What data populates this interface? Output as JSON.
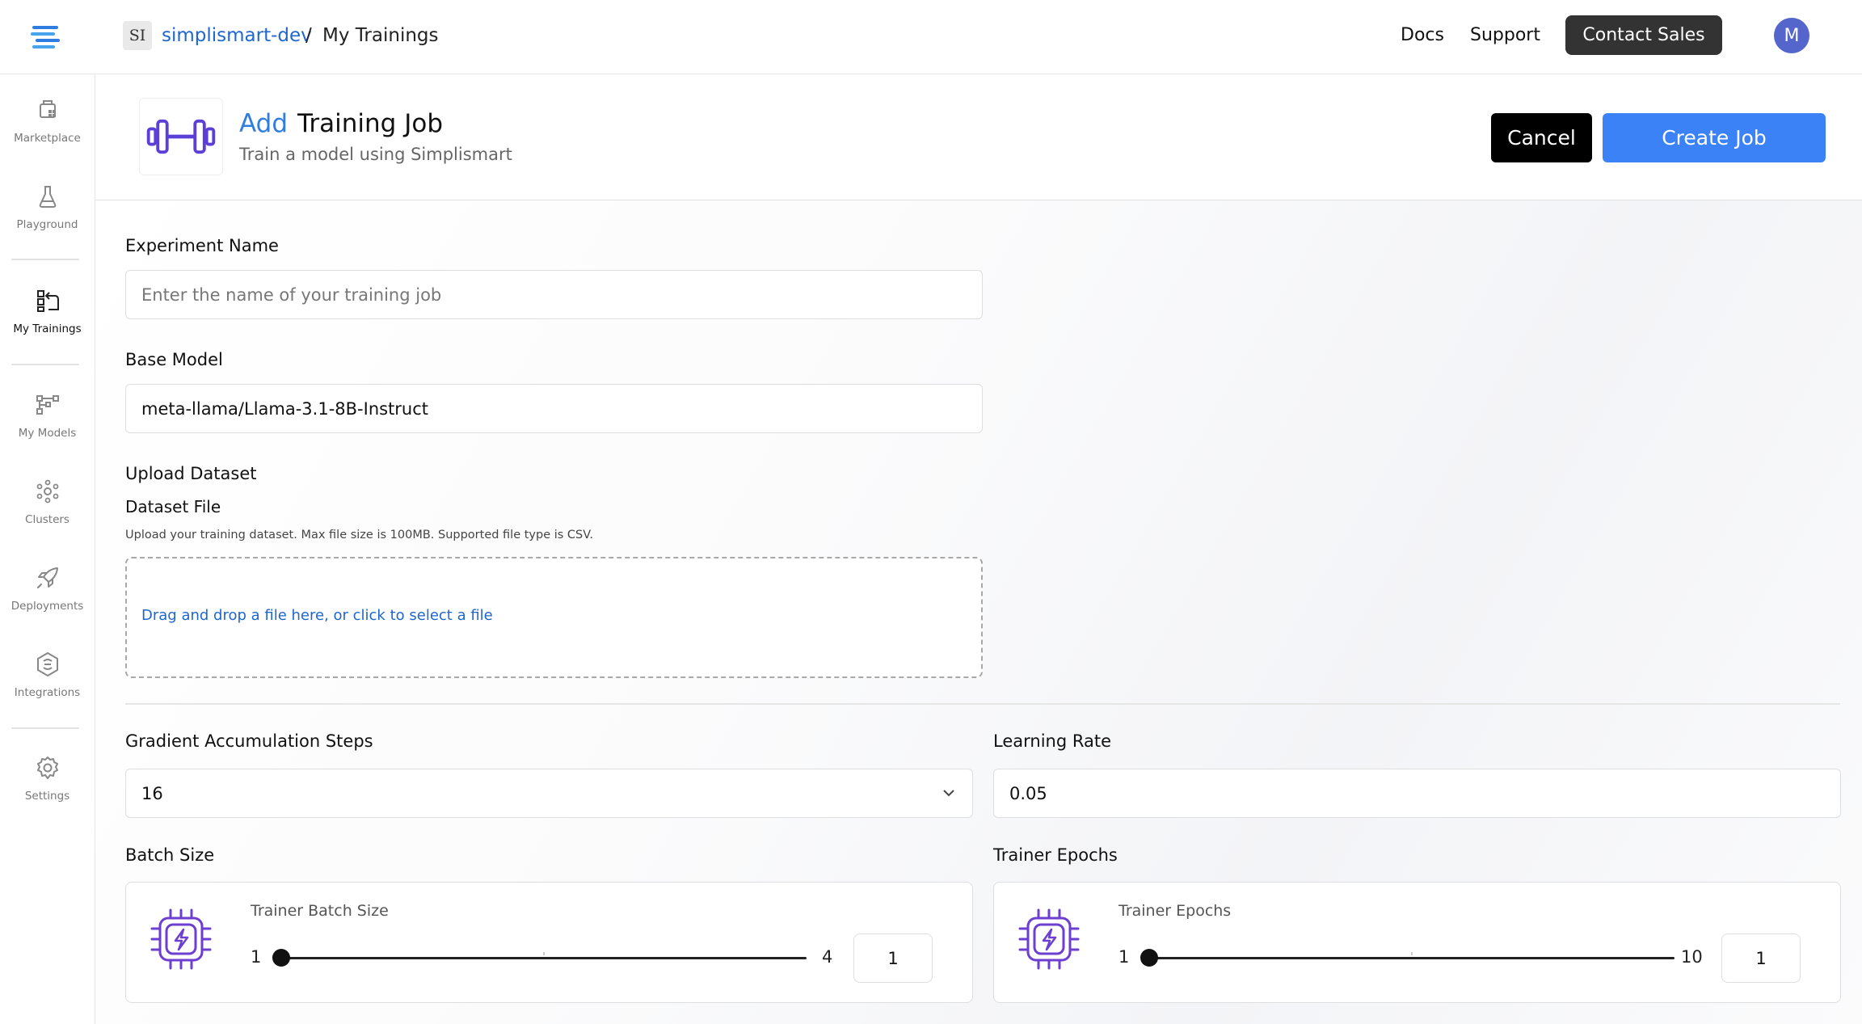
{
  "topbar": {
    "badge": "SI",
    "org": "simplismart-dev",
    "separator": "/",
    "page": "My Trainings",
    "links": {
      "docs": "Docs",
      "support": "Support"
    },
    "contact_label": "Contact Sales",
    "avatar_initial": "M"
  },
  "sidebar": {
    "items": [
      {
        "label": "Marketplace",
        "icon": "marketplace-icon"
      },
      {
        "label": "Playground",
        "icon": "flask-icon"
      },
      {
        "label": "My Trainings",
        "icon": "trainings-icon",
        "active": true
      },
      {
        "label": "My Models",
        "icon": "models-icon"
      },
      {
        "label": "Clusters",
        "icon": "clusters-icon"
      },
      {
        "label": "Deployments",
        "icon": "rocket-icon"
      },
      {
        "label": "Integrations",
        "icon": "integrations-icon"
      },
      {
        "label": "Settings",
        "icon": "gear-icon"
      }
    ]
  },
  "header": {
    "title_accent": "Add",
    "title": "Training Job",
    "subtitle": "Train a model using Simplismart",
    "cancel_label": "Cancel",
    "create_label": "Create Job"
  },
  "form": {
    "experiment_name": {
      "label": "Experiment Name",
      "placeholder": "Enter the name of your training job",
      "value": ""
    },
    "base_model": {
      "label": "Base Model",
      "value": "meta-llama/Llama-3.1-8B-Instruct"
    },
    "upload": {
      "section_label": "Upload Dataset",
      "file_label": "Dataset File",
      "hint": "Upload your training dataset. Max file size is 100MB. Supported file type is CSV.",
      "dropzone_text": "Drag and drop a file here, or click to select a file"
    },
    "gradient_accumulation": {
      "label": "Gradient Accumulation Steps",
      "value": "16"
    },
    "learning_rate": {
      "label": "Learning Rate",
      "value": "0.05"
    },
    "batch_size": {
      "label": "Batch Size",
      "card_title": "Trainer Batch Size",
      "min": "1",
      "max": "4",
      "value": "1"
    },
    "epochs": {
      "label": "Trainer Epochs",
      "card_title": "Trainer Epochs",
      "min": "1",
      "max": "10",
      "value": "1"
    }
  },
  "colors": {
    "accent": "#3b82f6",
    "link": "#1e66d0",
    "icon_purple": "#6d3fd1"
  }
}
